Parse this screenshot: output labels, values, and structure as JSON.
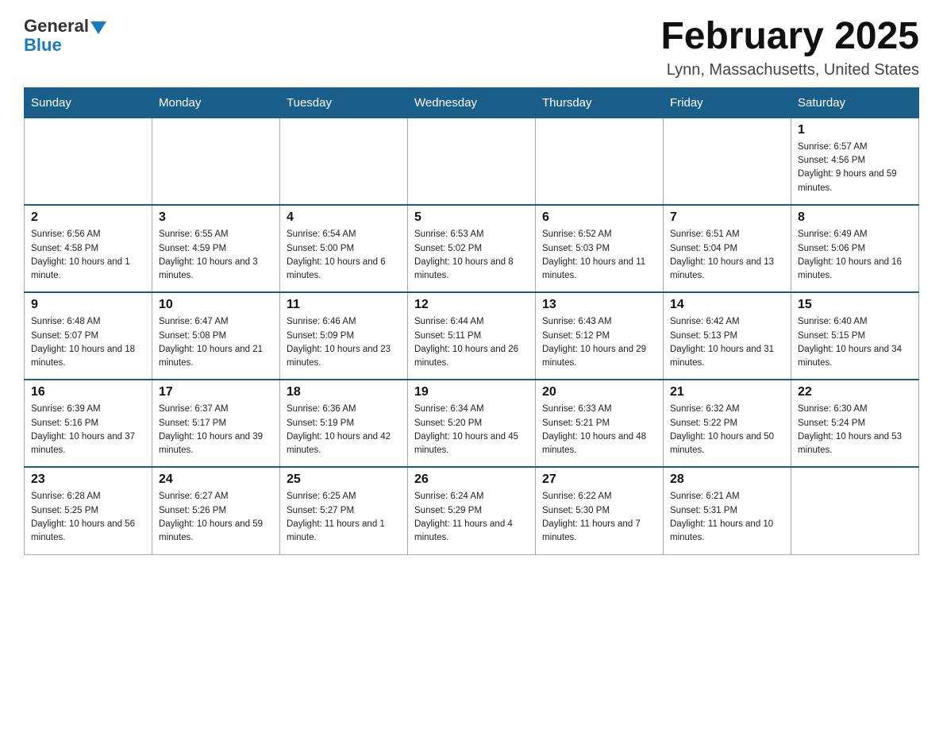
{
  "header": {
    "logo_general": "General",
    "logo_blue": "Blue",
    "month_title": "February 2025",
    "location": "Lynn, Massachusetts, United States"
  },
  "days_of_week": [
    "Sunday",
    "Monday",
    "Tuesday",
    "Wednesday",
    "Thursday",
    "Friday",
    "Saturday"
  ],
  "weeks": [
    [
      {
        "day": "",
        "sunrise": "",
        "sunset": "",
        "daylight": ""
      },
      {
        "day": "",
        "sunrise": "",
        "sunset": "",
        "daylight": ""
      },
      {
        "day": "",
        "sunrise": "",
        "sunset": "",
        "daylight": ""
      },
      {
        "day": "",
        "sunrise": "",
        "sunset": "",
        "daylight": ""
      },
      {
        "day": "",
        "sunrise": "",
        "sunset": "",
        "daylight": ""
      },
      {
        "day": "",
        "sunrise": "",
        "sunset": "",
        "daylight": ""
      },
      {
        "day": "1",
        "sunrise": "Sunrise: 6:57 AM",
        "sunset": "Sunset: 4:56 PM",
        "daylight": "Daylight: 9 hours and 59 minutes."
      }
    ],
    [
      {
        "day": "2",
        "sunrise": "Sunrise: 6:56 AM",
        "sunset": "Sunset: 4:58 PM",
        "daylight": "Daylight: 10 hours and 1 minute."
      },
      {
        "day": "3",
        "sunrise": "Sunrise: 6:55 AM",
        "sunset": "Sunset: 4:59 PM",
        "daylight": "Daylight: 10 hours and 3 minutes."
      },
      {
        "day": "4",
        "sunrise": "Sunrise: 6:54 AM",
        "sunset": "Sunset: 5:00 PM",
        "daylight": "Daylight: 10 hours and 6 minutes."
      },
      {
        "day": "5",
        "sunrise": "Sunrise: 6:53 AM",
        "sunset": "Sunset: 5:02 PM",
        "daylight": "Daylight: 10 hours and 8 minutes."
      },
      {
        "day": "6",
        "sunrise": "Sunrise: 6:52 AM",
        "sunset": "Sunset: 5:03 PM",
        "daylight": "Daylight: 10 hours and 11 minutes."
      },
      {
        "day": "7",
        "sunrise": "Sunrise: 6:51 AM",
        "sunset": "Sunset: 5:04 PM",
        "daylight": "Daylight: 10 hours and 13 minutes."
      },
      {
        "day": "8",
        "sunrise": "Sunrise: 6:49 AM",
        "sunset": "Sunset: 5:06 PM",
        "daylight": "Daylight: 10 hours and 16 minutes."
      }
    ],
    [
      {
        "day": "9",
        "sunrise": "Sunrise: 6:48 AM",
        "sunset": "Sunset: 5:07 PM",
        "daylight": "Daylight: 10 hours and 18 minutes."
      },
      {
        "day": "10",
        "sunrise": "Sunrise: 6:47 AM",
        "sunset": "Sunset: 5:08 PM",
        "daylight": "Daylight: 10 hours and 21 minutes."
      },
      {
        "day": "11",
        "sunrise": "Sunrise: 6:46 AM",
        "sunset": "Sunset: 5:09 PM",
        "daylight": "Daylight: 10 hours and 23 minutes."
      },
      {
        "day": "12",
        "sunrise": "Sunrise: 6:44 AM",
        "sunset": "Sunset: 5:11 PM",
        "daylight": "Daylight: 10 hours and 26 minutes."
      },
      {
        "day": "13",
        "sunrise": "Sunrise: 6:43 AM",
        "sunset": "Sunset: 5:12 PM",
        "daylight": "Daylight: 10 hours and 29 minutes."
      },
      {
        "day": "14",
        "sunrise": "Sunrise: 6:42 AM",
        "sunset": "Sunset: 5:13 PM",
        "daylight": "Daylight: 10 hours and 31 minutes."
      },
      {
        "day": "15",
        "sunrise": "Sunrise: 6:40 AM",
        "sunset": "Sunset: 5:15 PM",
        "daylight": "Daylight: 10 hours and 34 minutes."
      }
    ],
    [
      {
        "day": "16",
        "sunrise": "Sunrise: 6:39 AM",
        "sunset": "Sunset: 5:16 PM",
        "daylight": "Daylight: 10 hours and 37 minutes."
      },
      {
        "day": "17",
        "sunrise": "Sunrise: 6:37 AM",
        "sunset": "Sunset: 5:17 PM",
        "daylight": "Daylight: 10 hours and 39 minutes."
      },
      {
        "day": "18",
        "sunrise": "Sunrise: 6:36 AM",
        "sunset": "Sunset: 5:19 PM",
        "daylight": "Daylight: 10 hours and 42 minutes."
      },
      {
        "day": "19",
        "sunrise": "Sunrise: 6:34 AM",
        "sunset": "Sunset: 5:20 PM",
        "daylight": "Daylight: 10 hours and 45 minutes."
      },
      {
        "day": "20",
        "sunrise": "Sunrise: 6:33 AM",
        "sunset": "Sunset: 5:21 PM",
        "daylight": "Daylight: 10 hours and 48 minutes."
      },
      {
        "day": "21",
        "sunrise": "Sunrise: 6:32 AM",
        "sunset": "Sunset: 5:22 PM",
        "daylight": "Daylight: 10 hours and 50 minutes."
      },
      {
        "day": "22",
        "sunrise": "Sunrise: 6:30 AM",
        "sunset": "Sunset: 5:24 PM",
        "daylight": "Daylight: 10 hours and 53 minutes."
      }
    ],
    [
      {
        "day": "23",
        "sunrise": "Sunrise: 6:28 AM",
        "sunset": "Sunset: 5:25 PM",
        "daylight": "Daylight: 10 hours and 56 minutes."
      },
      {
        "day": "24",
        "sunrise": "Sunrise: 6:27 AM",
        "sunset": "Sunset: 5:26 PM",
        "daylight": "Daylight: 10 hours and 59 minutes."
      },
      {
        "day": "25",
        "sunrise": "Sunrise: 6:25 AM",
        "sunset": "Sunset: 5:27 PM",
        "daylight": "Daylight: 11 hours and 1 minute."
      },
      {
        "day": "26",
        "sunrise": "Sunrise: 6:24 AM",
        "sunset": "Sunset: 5:29 PM",
        "daylight": "Daylight: 11 hours and 4 minutes."
      },
      {
        "day": "27",
        "sunrise": "Sunrise: 6:22 AM",
        "sunset": "Sunset: 5:30 PM",
        "daylight": "Daylight: 11 hours and 7 minutes."
      },
      {
        "day": "28",
        "sunrise": "Sunrise: 6:21 AM",
        "sunset": "Sunset: 5:31 PM",
        "daylight": "Daylight: 11 hours and 10 minutes."
      },
      {
        "day": "",
        "sunrise": "",
        "sunset": "",
        "daylight": ""
      }
    ]
  ]
}
